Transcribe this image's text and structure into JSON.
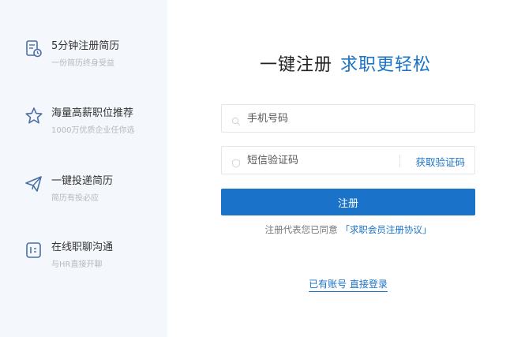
{
  "sidebar": {
    "features": [
      {
        "icon": "resume-clock-icon",
        "title": "5分钟注册简历",
        "subtitle": "一份简历终身受益"
      },
      {
        "icon": "star-icon",
        "title": "海量高薪职位推荐",
        "subtitle": "1000万优质企业任你选"
      },
      {
        "icon": "paper-plane-icon",
        "title": "一键投递简历",
        "subtitle": "简历有投必应"
      },
      {
        "icon": "chat-icon",
        "title": "在线职聊沟通",
        "subtitle": "与HR直接开聊"
      }
    ]
  },
  "form": {
    "headline_main": "一键注册",
    "headline_accent": "求职更轻松",
    "phone_placeholder": "手机号码",
    "code_placeholder": "短信验证码",
    "get_code_label": "获取验证码",
    "register_label": "注册",
    "agreement_prefix": "注册代表您已同意",
    "agreement_link": "「求职会员注册协议」",
    "login_label": "已有账号 直接登录"
  },
  "colors": {
    "accent": "#1a73c8",
    "sidebar_bg": "#f4f7fb",
    "icon": "#4a6fa5"
  }
}
